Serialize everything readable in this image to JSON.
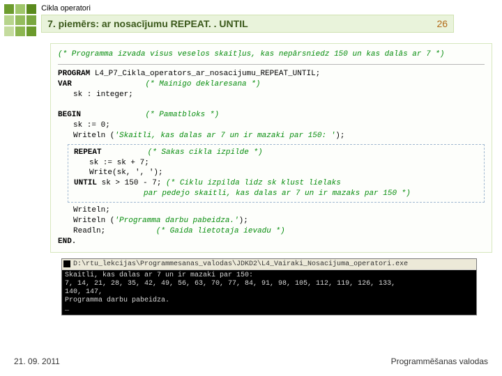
{
  "header": {
    "topic": "Cikla operatori",
    "title": "7. piemērs: ar nosacījumu REPEAT. . UNTIL",
    "page": "26"
  },
  "code": {
    "topComment": "(* Programma izvada visus veselos skaitļus, kas nepārsniedz 150 un kas dalās ar 7 *)",
    "progKw": "PROGRAM",
    "progName": " L4_P7_Cikla_operators_ar_nosacijumu_REPEAT_UNTIL;",
    "varKw": "VAR",
    "varComment": "(* Mainigo deklaresana *)",
    "varDecl": "sk : integer;",
    "beginKw": "BEGIN",
    "beginComment": "(* Pamatbloks *)",
    "assign0": "sk := 0;",
    "write1a": "Writeln (",
    "write1b": "'Skaitli, kas dalas ar 7 un ir mazaki par 150: '",
    "write1c": ");",
    "repeatKw": "REPEAT",
    "repeatComment": "(* Sakas cikla izpilde *)",
    "repBody1": "sk := sk + 7;",
    "repBody2": "Write(sk, ', ');",
    "untilKw": "UNTIL",
    "untilCond": " sk > 150 - 7; ",
    "untilComment1": "(* Ciklu izpilda lidz sk klust lielaks",
    "untilComment2": "par pedejo skaitli, kas dalas ar 7 un ir mazaks par 150 *)",
    "writeln2": "Writeln;",
    "write3a": "Writeln (",
    "write3b": "'Programma darbu pabeidza.'",
    "write3c": ");",
    "readln": "Readln;",
    "readlnComment": "(* Gaida lietotaja ievadu *)",
    "endKw": "END."
  },
  "console": {
    "path": "D:\\rtu_lekcijas\\Programmesanas_valodas\\JDKD2\\L4_Vairaki_Nosacijuma_operatori.exe",
    "line1": "Skaitli, kas dalas ar 7 un ir mazaki par 150:",
    "line2": "7, 14, 21, 28, 35, 42, 49, 56, 63, 70, 77, 84, 91, 98, 105, 112, 119, 126, 133,",
    "line3": "140, 147,",
    "line4": "Programma darbu pabeidza.",
    "line5": "_"
  },
  "footer": {
    "date": "21. 09. 2011",
    "course": "Programmēšanas valodas"
  }
}
